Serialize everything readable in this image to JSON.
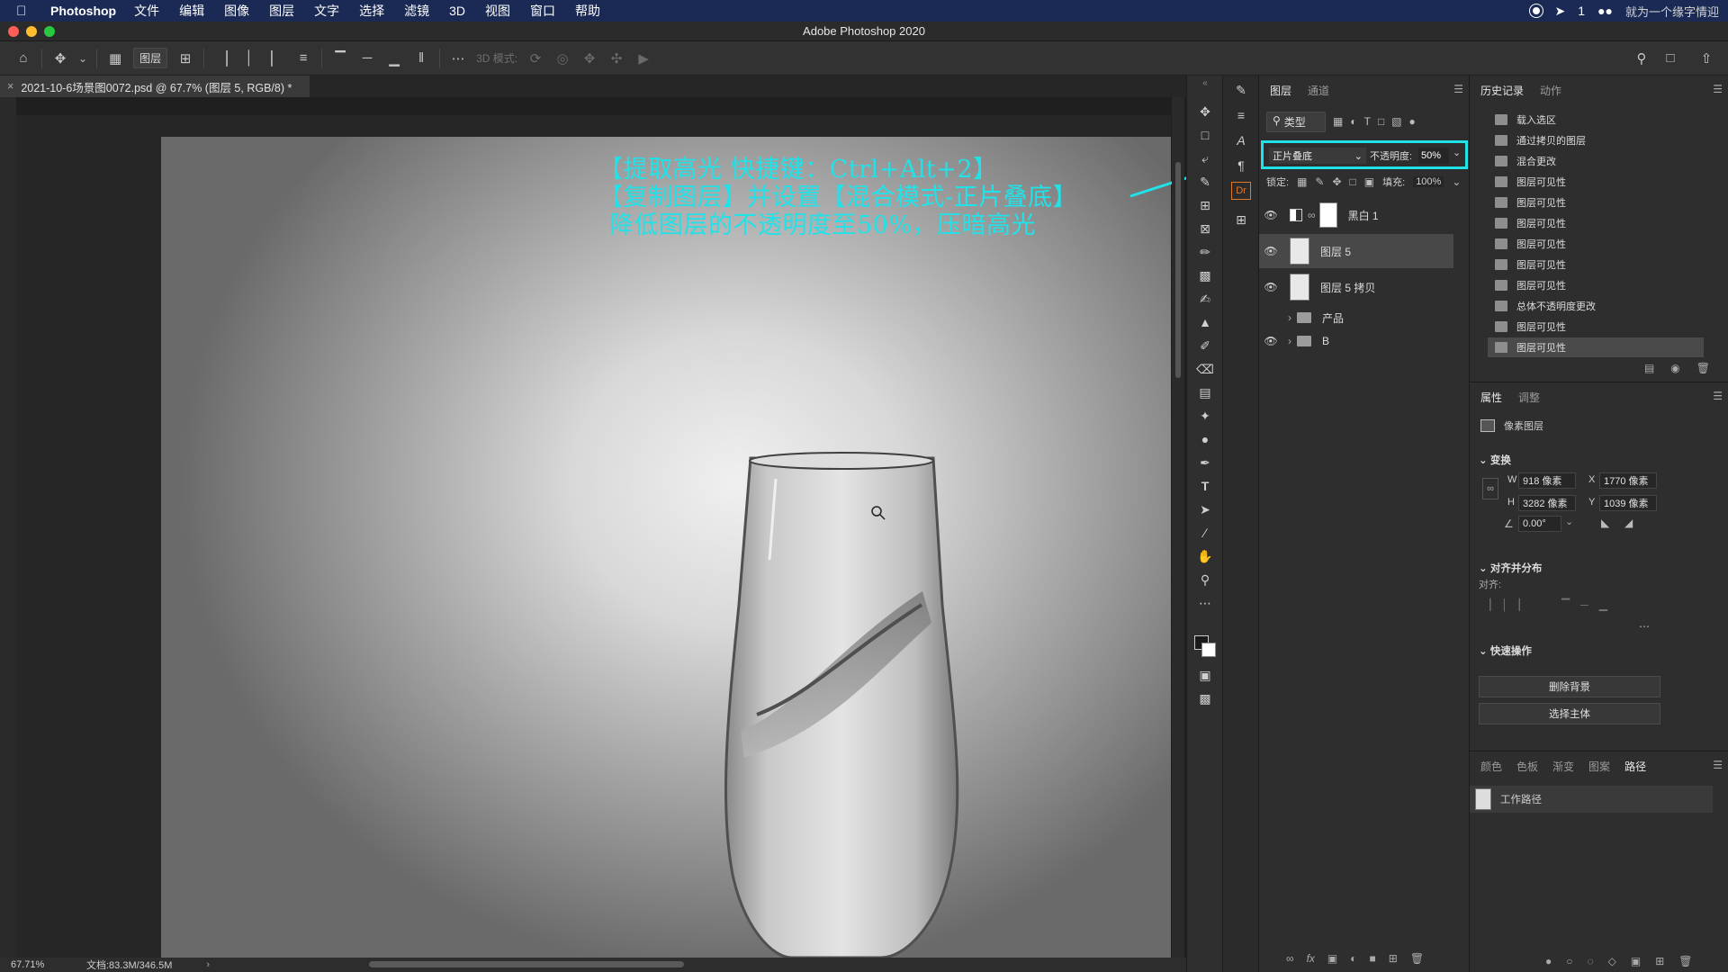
{
  "menubar": {
    "app_name": "Photoshop",
    "items": [
      "文件",
      "编辑",
      "图像",
      "图层",
      "文字",
      "选择",
      "滤镜",
      "3D",
      "视图",
      "窗口",
      "帮助"
    ],
    "status": "1",
    "watermark": "就为一个缘字情迎"
  },
  "window": {
    "title": "Adobe Photoshop 2020"
  },
  "options": {
    "auto_select_target": "图层",
    "three_d_mode": "3D 模式:"
  },
  "document": {
    "tab_title": "2021-10-6场景图0072.psd @ 67.7% (图层 5, RGB/8) *",
    "zoom": "67.71%",
    "doc_size": "文档:83.3M/346.5M"
  },
  "annotation": {
    "line1": "【提取高光 快捷键：Ctrl+Alt+2】",
    "line2": "【复制图层】并设置【混合模式-正片叠底】",
    "line3": "降低图层的不透明度至50%，压暗高光",
    "accent_color": "#21e2e8"
  },
  "layers_panel": {
    "tabs": [
      "图层",
      "通道"
    ],
    "filter_kind": "类型",
    "blend_mode": "正片叠底",
    "opacity_label": "不透明度:",
    "opacity_value": "50%",
    "lock_label": "锁定:",
    "fill_label": "填充:",
    "fill_value": "100%",
    "layers": [
      {
        "name": "黑白 1",
        "type": "adjustment",
        "visible": true,
        "selected": false
      },
      {
        "name": "图层 5",
        "type": "pixel",
        "visible": true,
        "selected": true
      },
      {
        "name": "图层 5 拷贝",
        "type": "pixel",
        "visible": true,
        "selected": false
      },
      {
        "name": "产品",
        "type": "group",
        "visible": false,
        "selected": false
      },
      {
        "name": "B",
        "type": "group",
        "visible": true,
        "selected": false
      }
    ]
  },
  "history_panel": {
    "tabs": [
      "历史记录",
      "动作"
    ],
    "items": [
      "载入选区",
      "通过拷贝的图层",
      "混合更改",
      "图层可见性",
      "图层可见性",
      "图层可见性",
      "图层可见性",
      "图层可见性",
      "图层可见性",
      "总体不透明度更改",
      "图层可见性",
      "图层可见性"
    ]
  },
  "properties_panel": {
    "tabs": [
      "属性",
      "调整"
    ],
    "kind": "像素图层",
    "transform_title": "变换",
    "w_label": "W",
    "w_value": "918 像素",
    "h_label": "H",
    "h_value": "3282 像素",
    "x_label": "X",
    "x_value": "1770 像素",
    "y_label": "Y",
    "y_value": "1039 像素",
    "angle_value": "0.00°",
    "align_title": "对齐并分布",
    "align_label": "对齐:",
    "quick_title": "快速操作",
    "remove_bg": "删除背景",
    "select_subject": "选择主体"
  },
  "paths_panel": {
    "tabs": [
      "颜色",
      "色板",
      "渐变",
      "图案",
      "路径"
    ],
    "work_path": "工作路径"
  }
}
